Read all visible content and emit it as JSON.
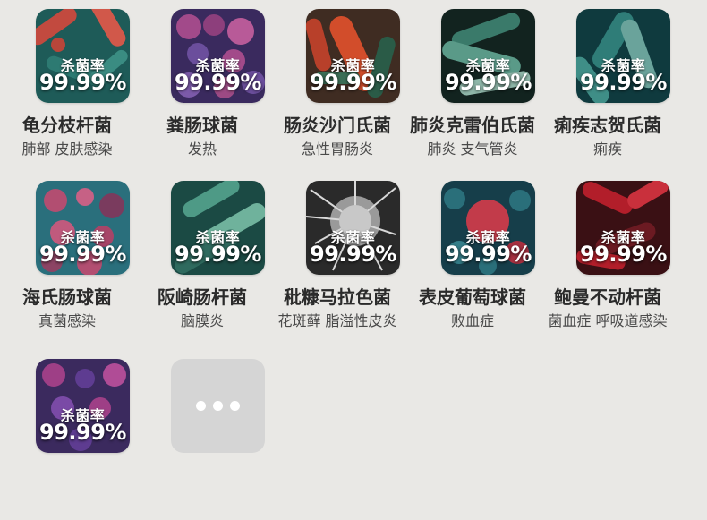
{
  "common": {
    "kill_label": "杀菌率",
    "kill_rate": "99.99%"
  },
  "items": [
    {
      "name": "龟分枝杆菌",
      "desc": "肺部 皮肤感染",
      "palette": [
        "#1e5b58",
        "#c24a3f",
        "#2d7a72"
      ]
    },
    {
      "name": "粪肠球菌",
      "desc": "发热",
      "palette": [
        "#3a2a5e",
        "#a24a8a",
        "#6b4e9c"
      ]
    },
    {
      "name": "肠炎沙门氏菌",
      "desc": "急性胃肠炎",
      "palette": [
        "#3f2c22",
        "#d24d2b",
        "#2a5b47"
      ]
    },
    {
      "name": "肺炎克雷伯氏菌",
      "desc": "肺炎 支气管炎",
      "palette": [
        "#12231f",
        "#3a7a6a",
        "#8fb7a9"
      ]
    },
    {
      "name": "痢疾志贺氏菌",
      "desc": "痢疾",
      "palette": [
        "#0f3a3e",
        "#2f7d78",
        "#6aa39b"
      ]
    },
    {
      "name": "海氏肠球菌",
      "desc": "真菌感染",
      "palette": [
        "#2a6f7c",
        "#b24e71",
        "#7a3b5e"
      ]
    },
    {
      "name": "阪崎肠杆菌",
      "desc": "脑膜炎",
      "palette": [
        "#1b4a44",
        "#4e9a86",
        "#2f6a5e"
      ]
    },
    {
      "name": "秕糠马拉色菌",
      "desc": "花斑藓 脂溢性皮炎",
      "palette": [
        "#2a2a2a",
        "#9a9a9a",
        "#d8d8d8"
      ]
    },
    {
      "name": "表皮葡萄球菌",
      "desc": "败血症",
      "palette": [
        "#163e4a",
        "#c23b4a",
        "#2a6f7a"
      ]
    },
    {
      "name": "鲍曼不动杆菌",
      "desc": "菌血症 呼吸道感染",
      "palette": [
        "#3a1014",
        "#b21e2a",
        "#6b1a22"
      ]
    },
    {
      "name": "",
      "desc": "",
      "palette": [
        "#3b2a5e",
        "#9e3f86",
        "#5e3c91"
      ]
    }
  ],
  "more": {
    "label": "more-button"
  }
}
